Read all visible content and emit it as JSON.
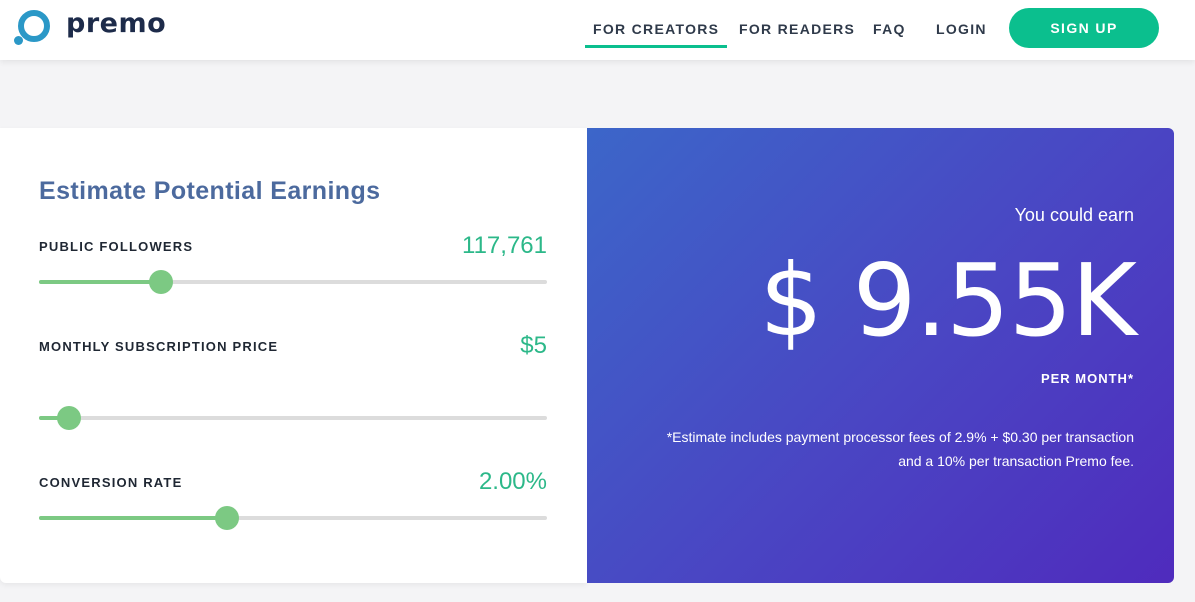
{
  "brand": {
    "name": "premo",
    "color": "#2b98c7"
  },
  "nav": {
    "items": [
      {
        "label": "FOR CREATORS",
        "active": true
      },
      {
        "label": "FOR READERS",
        "active": false
      },
      {
        "label": "FAQ",
        "active": false
      },
      {
        "label": "LOGIN",
        "active": false
      }
    ],
    "signup_label": "SIGN UP",
    "accent_color": "#0bbf8e"
  },
  "calculator": {
    "title": "Estimate Potential Earnings",
    "fields": [
      {
        "label": "PUBLIC FOLLOWERS",
        "value": "117,761",
        "slider_fraction": 0.24
      },
      {
        "label": "MONTHLY SUBSCRIPTION PRICE",
        "value": "$5",
        "slider_fraction": 0.06
      },
      {
        "label": "CONVERSION RATE",
        "value": "2.00%",
        "slider_fraction": 0.37
      }
    ],
    "slider_color": "#7cc983"
  },
  "result": {
    "label": "You could earn",
    "amount": "$ 9.55K",
    "period": "PER MONTH*",
    "disclaimer_line1": "*Estimate includes payment processor fees of 2.9% + $0.30 per transaction",
    "disclaimer_line2": "and a 10% per transaction Premo fee."
  }
}
